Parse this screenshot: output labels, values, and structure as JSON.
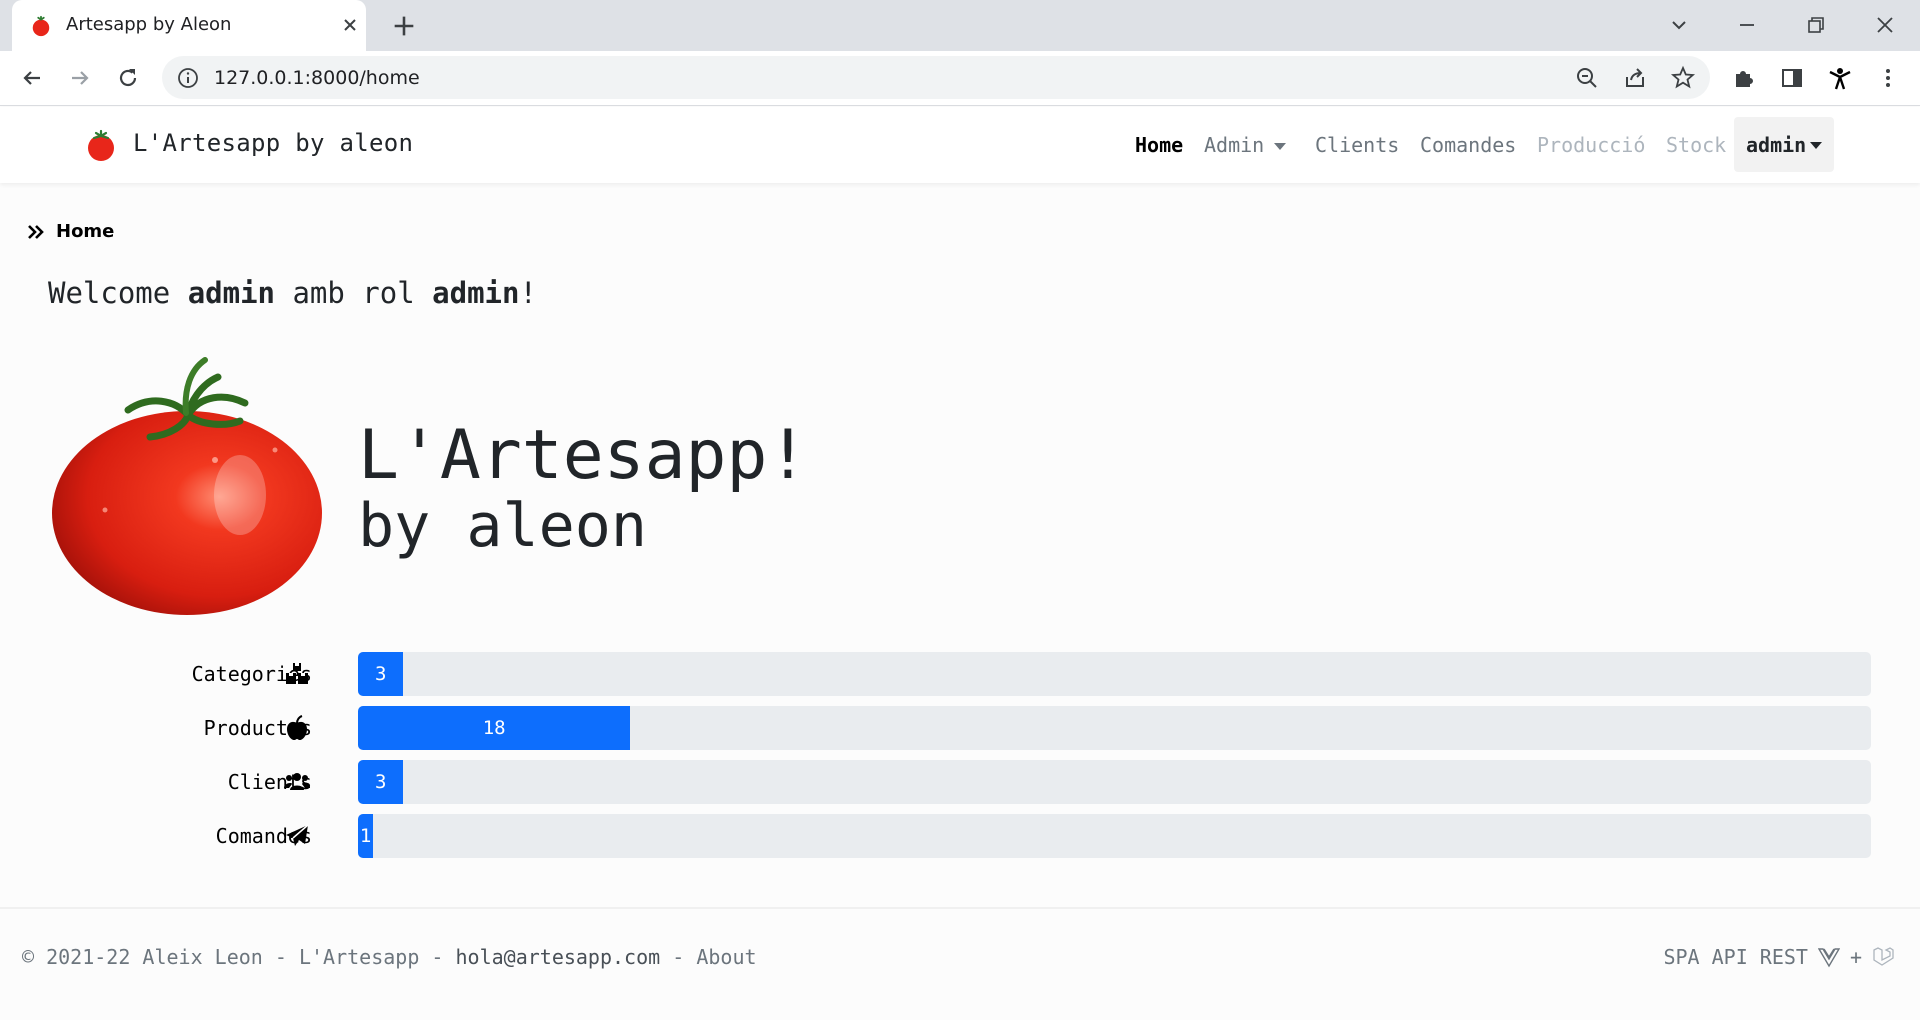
{
  "browser": {
    "tab_title": "Artesapp by Aleon",
    "url": "127.0.0.1:8000/home"
  },
  "navbar": {
    "brand": "L'Artesapp by aleon",
    "links": [
      {
        "label": "Home",
        "state": "active"
      },
      {
        "label": "Admin",
        "state": "dropdown"
      },
      {
        "label": "Clients",
        "state": "normal"
      },
      {
        "label": "Comandes",
        "state": "normal"
      },
      {
        "label": "Producció",
        "state": "disabled"
      },
      {
        "label": "Stock",
        "state": "disabled"
      }
    ],
    "user": "admin"
  },
  "breadcrumb": {
    "label": "Home"
  },
  "welcome": {
    "prefix": "Welcome",
    "user": "admin",
    "middle": "amb rol",
    "role": "admin",
    "suffix": "!"
  },
  "hero": {
    "title": "L'Artesapp!",
    "subtitle": "by aleon"
  },
  "stats": {
    "max": 100,
    "items": [
      {
        "label": "Categories",
        "icon": "boxes-icon",
        "value": 3
      },
      {
        "label": "Productes",
        "icon": "apple-icon",
        "value": 18
      },
      {
        "label": "Clients",
        "icon": "users-icon",
        "value": 3
      },
      {
        "label": "Comandes",
        "icon": "paper-plane-icon",
        "value": 1
      }
    ]
  },
  "footer": {
    "copyright": "© 2021-22 Aleix Leon - L'Artesapp -",
    "email": "hola@artesapp.com",
    "sep": "-",
    "about": "About",
    "right_text": "SPA API REST",
    "plus": "+"
  },
  "colors": {
    "progress": "#0d6efd",
    "track": "#e9ecef",
    "tomato": "#e8261a"
  }
}
